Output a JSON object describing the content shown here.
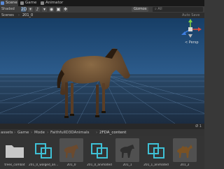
{
  "tabs": [
    {
      "label": "Scene",
      "active": true
    },
    {
      "label": "Game",
      "active": false
    },
    {
      "label": "Animator",
      "active": false
    }
  ],
  "toolbar": {
    "shading": "Shaded",
    "mode_2d": "2D",
    "gizmos": "Gizmos",
    "search_placeholder": "All"
  },
  "breadcrumb": {
    "root": "Scenes",
    "current": "201_0",
    "auto_save": "Auto Save"
  },
  "scene": {
    "projection": "< Persp",
    "bottom_strip": "Ø 1"
  },
  "path": [
    "assets",
    "Game",
    "Mode",
    "FaithfulID3DAnimals",
    "2FDA_content"
  ],
  "assets": [
    {
      "label": "trees_combat",
      "kind": "folder"
    },
    {
      "label": "201_0_walged_an...",
      "kind": "prefab"
    },
    {
      "label": "201_0",
      "kind": "model",
      "color": "#6b4a2e"
    },
    {
      "label": "201_0_animated",
      "kind": "prefab"
    },
    {
      "label": "201_1",
      "kind": "model",
      "color": "#3a3a3a"
    },
    {
      "label": "201_1_animated",
      "kind": "prefab"
    },
    {
      "label": "201_2",
      "kind": "model",
      "color": "#7a5224"
    }
  ],
  "colors": {
    "accent": "#5a8ad6",
    "sky_top": "#1a4770",
    "horizon": "#2c5a8a",
    "ground": "#1e2f44",
    "prefab": "#3fc1d6",
    "axis_x": "#e04a3a",
    "axis_y": "#7ed043",
    "axis_z": "#3d7ee0"
  }
}
